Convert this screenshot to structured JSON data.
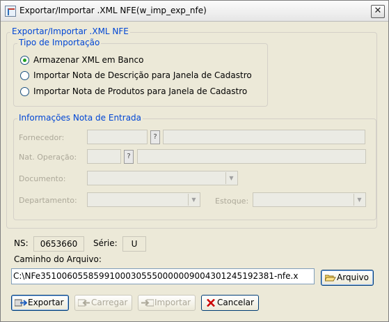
{
  "window": {
    "title": "Exportar/Importar .XML NFE(w_imp_exp_nfe)",
    "close_glyph": "✕"
  },
  "main_group": {
    "legend": "Exportar/Importar .XML NFE"
  },
  "tipo_importacao": {
    "legend": "Tipo de Importação",
    "options": [
      {
        "label": "Armazenar XML em Banco",
        "selected": true
      },
      {
        "label": "Importar Nota de Descrição para Janela de Cadastro",
        "selected": false
      },
      {
        "label": "Importar Nota de Produtos para Janela de Cadastro",
        "selected": false
      }
    ]
  },
  "nota_entrada": {
    "legend": "Informações Nota de Entrada",
    "fornecedor_label": "Fornecedor:",
    "nat_operacao_label": "Nat. Operação:",
    "documento_label": "Documento:",
    "departamento_label": "Departamento:",
    "estoque_label": "Estoque:",
    "lookup_glyph": "?",
    "dropdown_glyph": "▼"
  },
  "ns": {
    "label": "NS:",
    "value": "0653660"
  },
  "serie": {
    "label": "Série:",
    "value": "U"
  },
  "caminho": {
    "label": "Caminho do Arquivo:",
    "value": "C:\\NFe35100605585991000305550000009004301245192381-nfe.x"
  },
  "buttons": {
    "arquivo": "Arquivo",
    "exportar": "Exportar",
    "carregar": "Carregar",
    "importar": "Importar",
    "cancelar": "Cancelar"
  },
  "colors": {
    "window_bg": "#ece9d8",
    "legend_blue": "#0046d5",
    "disabled_text": "#aca899",
    "radio_dot": "#21a121",
    "cancel_icon": "#cc0000"
  },
  "icons": {
    "app": "nfe-app-icon",
    "arquivo": "folder-open-icon",
    "exportar": "export-icon",
    "carregar": "load-icon",
    "importar": "import-icon",
    "cancelar": "cancel-x-icon"
  }
}
